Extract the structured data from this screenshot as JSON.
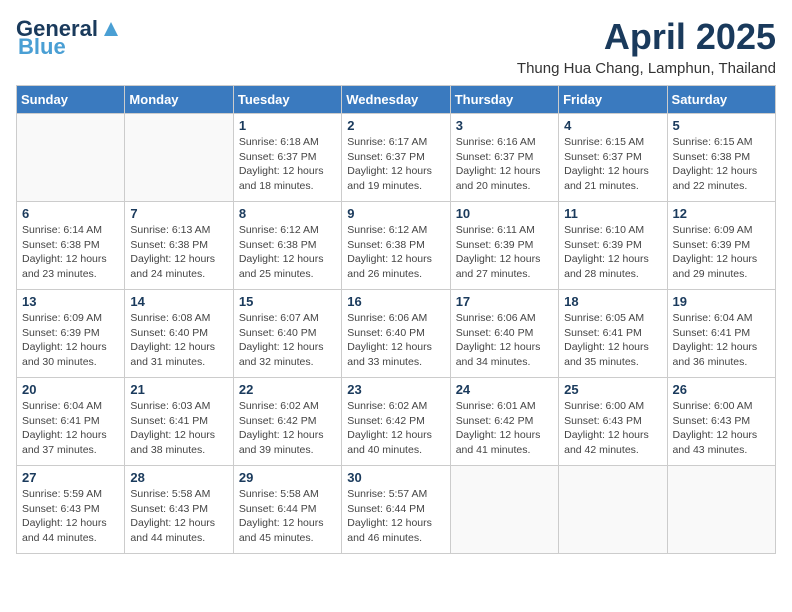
{
  "header": {
    "logo_line1": "General",
    "logo_line2": "Blue",
    "main_title": "April 2025",
    "subtitle": "Thung Hua Chang, Lamphun, Thailand"
  },
  "days_of_week": [
    "Sunday",
    "Monday",
    "Tuesday",
    "Wednesday",
    "Thursday",
    "Friday",
    "Saturday"
  ],
  "weeks": [
    [
      {
        "day": "",
        "info": ""
      },
      {
        "day": "",
        "info": ""
      },
      {
        "day": "1",
        "info": "Sunrise: 6:18 AM\nSunset: 6:37 PM\nDaylight: 12 hours and 18 minutes."
      },
      {
        "day": "2",
        "info": "Sunrise: 6:17 AM\nSunset: 6:37 PM\nDaylight: 12 hours and 19 minutes."
      },
      {
        "day": "3",
        "info": "Sunrise: 6:16 AM\nSunset: 6:37 PM\nDaylight: 12 hours and 20 minutes."
      },
      {
        "day": "4",
        "info": "Sunrise: 6:15 AM\nSunset: 6:37 PM\nDaylight: 12 hours and 21 minutes."
      },
      {
        "day": "5",
        "info": "Sunrise: 6:15 AM\nSunset: 6:38 PM\nDaylight: 12 hours and 22 minutes."
      }
    ],
    [
      {
        "day": "6",
        "info": "Sunrise: 6:14 AM\nSunset: 6:38 PM\nDaylight: 12 hours and 23 minutes."
      },
      {
        "day": "7",
        "info": "Sunrise: 6:13 AM\nSunset: 6:38 PM\nDaylight: 12 hours and 24 minutes."
      },
      {
        "day": "8",
        "info": "Sunrise: 6:12 AM\nSunset: 6:38 PM\nDaylight: 12 hours and 25 minutes."
      },
      {
        "day": "9",
        "info": "Sunrise: 6:12 AM\nSunset: 6:38 PM\nDaylight: 12 hours and 26 minutes."
      },
      {
        "day": "10",
        "info": "Sunrise: 6:11 AM\nSunset: 6:39 PM\nDaylight: 12 hours and 27 minutes."
      },
      {
        "day": "11",
        "info": "Sunrise: 6:10 AM\nSunset: 6:39 PM\nDaylight: 12 hours and 28 minutes."
      },
      {
        "day": "12",
        "info": "Sunrise: 6:09 AM\nSunset: 6:39 PM\nDaylight: 12 hours and 29 minutes."
      }
    ],
    [
      {
        "day": "13",
        "info": "Sunrise: 6:09 AM\nSunset: 6:39 PM\nDaylight: 12 hours and 30 minutes."
      },
      {
        "day": "14",
        "info": "Sunrise: 6:08 AM\nSunset: 6:40 PM\nDaylight: 12 hours and 31 minutes."
      },
      {
        "day": "15",
        "info": "Sunrise: 6:07 AM\nSunset: 6:40 PM\nDaylight: 12 hours and 32 minutes."
      },
      {
        "day": "16",
        "info": "Sunrise: 6:06 AM\nSunset: 6:40 PM\nDaylight: 12 hours and 33 minutes."
      },
      {
        "day": "17",
        "info": "Sunrise: 6:06 AM\nSunset: 6:40 PM\nDaylight: 12 hours and 34 minutes."
      },
      {
        "day": "18",
        "info": "Sunrise: 6:05 AM\nSunset: 6:41 PM\nDaylight: 12 hours and 35 minutes."
      },
      {
        "day": "19",
        "info": "Sunrise: 6:04 AM\nSunset: 6:41 PM\nDaylight: 12 hours and 36 minutes."
      }
    ],
    [
      {
        "day": "20",
        "info": "Sunrise: 6:04 AM\nSunset: 6:41 PM\nDaylight: 12 hours and 37 minutes."
      },
      {
        "day": "21",
        "info": "Sunrise: 6:03 AM\nSunset: 6:41 PM\nDaylight: 12 hours and 38 minutes."
      },
      {
        "day": "22",
        "info": "Sunrise: 6:02 AM\nSunset: 6:42 PM\nDaylight: 12 hours and 39 minutes."
      },
      {
        "day": "23",
        "info": "Sunrise: 6:02 AM\nSunset: 6:42 PM\nDaylight: 12 hours and 40 minutes."
      },
      {
        "day": "24",
        "info": "Sunrise: 6:01 AM\nSunset: 6:42 PM\nDaylight: 12 hours and 41 minutes."
      },
      {
        "day": "25",
        "info": "Sunrise: 6:00 AM\nSunset: 6:43 PM\nDaylight: 12 hours and 42 minutes."
      },
      {
        "day": "26",
        "info": "Sunrise: 6:00 AM\nSunset: 6:43 PM\nDaylight: 12 hours and 43 minutes."
      }
    ],
    [
      {
        "day": "27",
        "info": "Sunrise: 5:59 AM\nSunset: 6:43 PM\nDaylight: 12 hours and 44 minutes."
      },
      {
        "day": "28",
        "info": "Sunrise: 5:58 AM\nSunset: 6:43 PM\nDaylight: 12 hours and 44 minutes."
      },
      {
        "day": "29",
        "info": "Sunrise: 5:58 AM\nSunset: 6:44 PM\nDaylight: 12 hours and 45 minutes."
      },
      {
        "day": "30",
        "info": "Sunrise: 5:57 AM\nSunset: 6:44 PM\nDaylight: 12 hours and 46 minutes."
      },
      {
        "day": "",
        "info": ""
      },
      {
        "day": "",
        "info": ""
      },
      {
        "day": "",
        "info": ""
      }
    ]
  ]
}
